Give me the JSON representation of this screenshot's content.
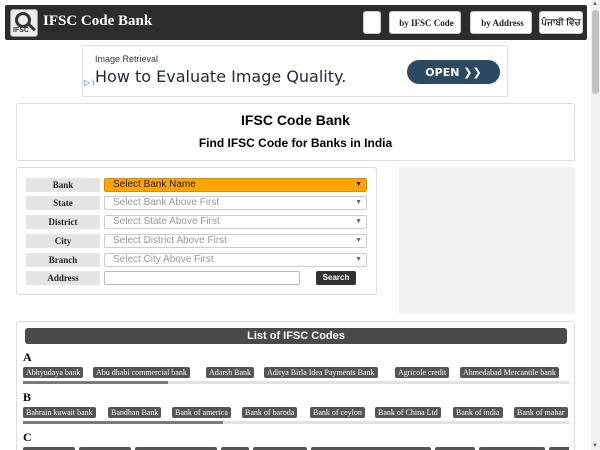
{
  "header": {
    "site_title": "IFSC Code Bank",
    "logo_text": "IFSC",
    "buttons": [
      {
        "icon": "",
        "label": ""
      },
      {
        "icon": "",
        "label": "by IFSC Code"
      },
      {
        "icon": "",
        "label": "by Address"
      },
      {
        "icon": "",
        "label": "ਪੰਜਾਬੀ ਵਿੱਚ"
      }
    ]
  },
  "ad": {
    "small_text": "Image Retrieval",
    "headline": "How to Evaluate Image Quality.",
    "cta": "OPEN ❯❯",
    "choice_icon": "▷ i"
  },
  "title_card": {
    "heading": "IFSC Code Bank",
    "subheading": "Find IFSC Code for Banks in India"
  },
  "form": {
    "rows": [
      {
        "label": "Bank",
        "value": "Select Bank Name"
      },
      {
        "label": "State",
        "value": "Select Bank Above First"
      },
      {
        "label": "District",
        "value": "Select State Above First"
      },
      {
        "label": "City",
        "value": "Select District Above First"
      },
      {
        "label": "Branch",
        "value": "Select City Above First"
      }
    ],
    "address_label": "Address",
    "address_value": "",
    "search_label": "Search",
    "accent": "#ffa500"
  },
  "codes": {
    "title": "List of IFSC Codes",
    "groups": [
      {
        "letter": "A",
        "banks": [
          "Abhyudaya bank",
          "Abu dhabi commercial bank",
          "Adarsh Bank",
          "Aditya Birla Idea Payments Bank",
          "Agricole credit",
          "Ahmedabad Mercantile bank"
        ]
      },
      {
        "letter": "B",
        "banks": [
          "Bahrain kuwait bank",
          "Bandhan Bank",
          "Bank of america",
          "Bank of baroda",
          "Bank of ceylon",
          "Bank of China Ltd",
          "Bank of india",
          "Bank of mahar"
        ]
      },
      {
        "letter": "C",
        "banks": []
      }
    ]
  }
}
